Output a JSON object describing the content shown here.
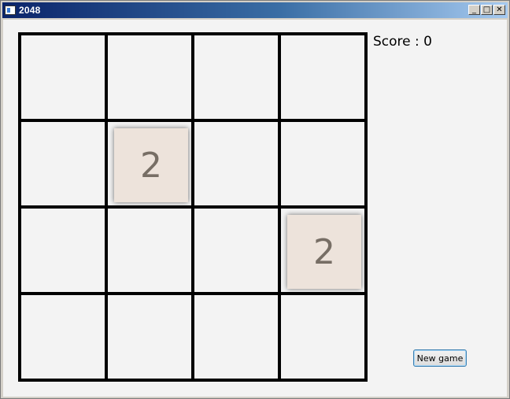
{
  "window": {
    "title": "2048",
    "minimize_glyph": "_",
    "maximize_glyph": "□",
    "close_glyph": "✕"
  },
  "game": {
    "score_label": "Score : 0",
    "score": 0,
    "grid_size": 4,
    "tiles": [
      {
        "row": 1,
        "col": 1,
        "value": "2"
      },
      {
        "row": 2,
        "col": 3,
        "value": "2"
      }
    ],
    "tile_color": "#ede3db",
    "tile_text_color": "#776e65",
    "new_game_label": "New game"
  }
}
